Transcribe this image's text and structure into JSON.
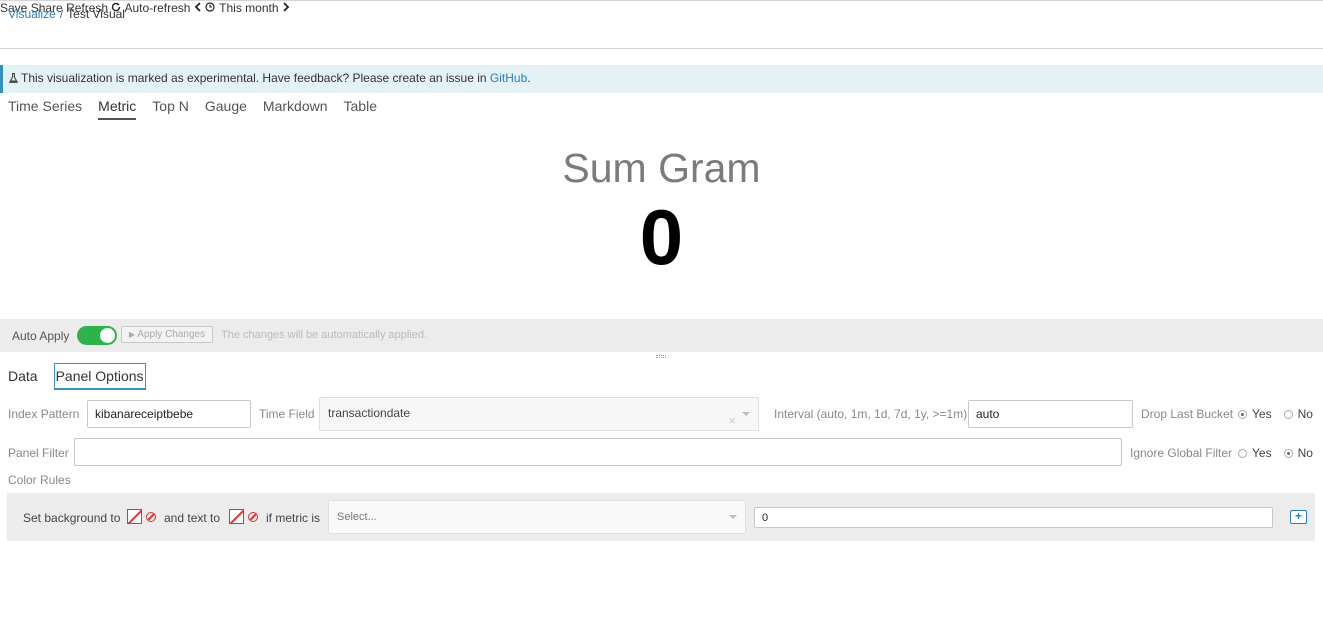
{
  "breadcrumb": {
    "root": "Visualize",
    "separator": "/",
    "current": "Test Visual"
  },
  "top_actions": {
    "save": "Save",
    "share": "Share",
    "refresh": "Refresh",
    "auto_refresh": "Auto-refresh",
    "time_range": "This month",
    "prev_icon": "chevron-left-icon",
    "next_icon": "chevron-right-icon"
  },
  "banner": {
    "text": "This visualization is marked as experimental. Have feedback? Please create an issue in ",
    "link": "GitHub",
    "suffix": "."
  },
  "vis_tabs": [
    {
      "label": "Time Series",
      "active": false
    },
    {
      "label": "Metric",
      "active": true
    },
    {
      "label": "Top N",
      "active": false
    },
    {
      "label": "Gauge",
      "active": false
    },
    {
      "label": "Markdown",
      "active": false
    },
    {
      "label": "Table",
      "active": false
    }
  ],
  "metric": {
    "label": "Sum Gram",
    "value": "0"
  },
  "apply_bar": {
    "label": "Auto Apply",
    "auto_apply_on": true,
    "apply_button": "Apply Changes",
    "note": "The changes will be automatically applied."
  },
  "panel_tabs": [
    {
      "label": "Data",
      "active": false
    },
    {
      "label": "Panel Options",
      "active": true
    }
  ],
  "options": {
    "index_pattern_label": "Index Pattern",
    "index_pattern_value": "kibanareceiptbebe",
    "time_field_label": "Time Field",
    "time_field_value": "transactiondate",
    "interval_label": "Interval (auto, 1m, 1d, 7d, 1y, >=1m)",
    "interval_value": "auto",
    "drop_last_bucket_label": "Drop Last Bucket",
    "drop_last_bucket": "Yes",
    "panel_filter_label": "Panel Filter",
    "panel_filter_value": "",
    "ignore_global_filter_label": "Ignore Global Filter",
    "ignore_global_filter": "No",
    "yes": "Yes",
    "no": "No"
  },
  "color_rules": {
    "title": "Color Rules",
    "set_background": "Set background to",
    "and_text": "and text to",
    "if_metric": "if metric is",
    "operator_placeholder": "Select...",
    "value": "0",
    "add": "+"
  },
  "colors": {
    "accent": "#2a7fb8",
    "toggle_on": "#2cb34a",
    "banner_bg": "#e4f2f6"
  }
}
